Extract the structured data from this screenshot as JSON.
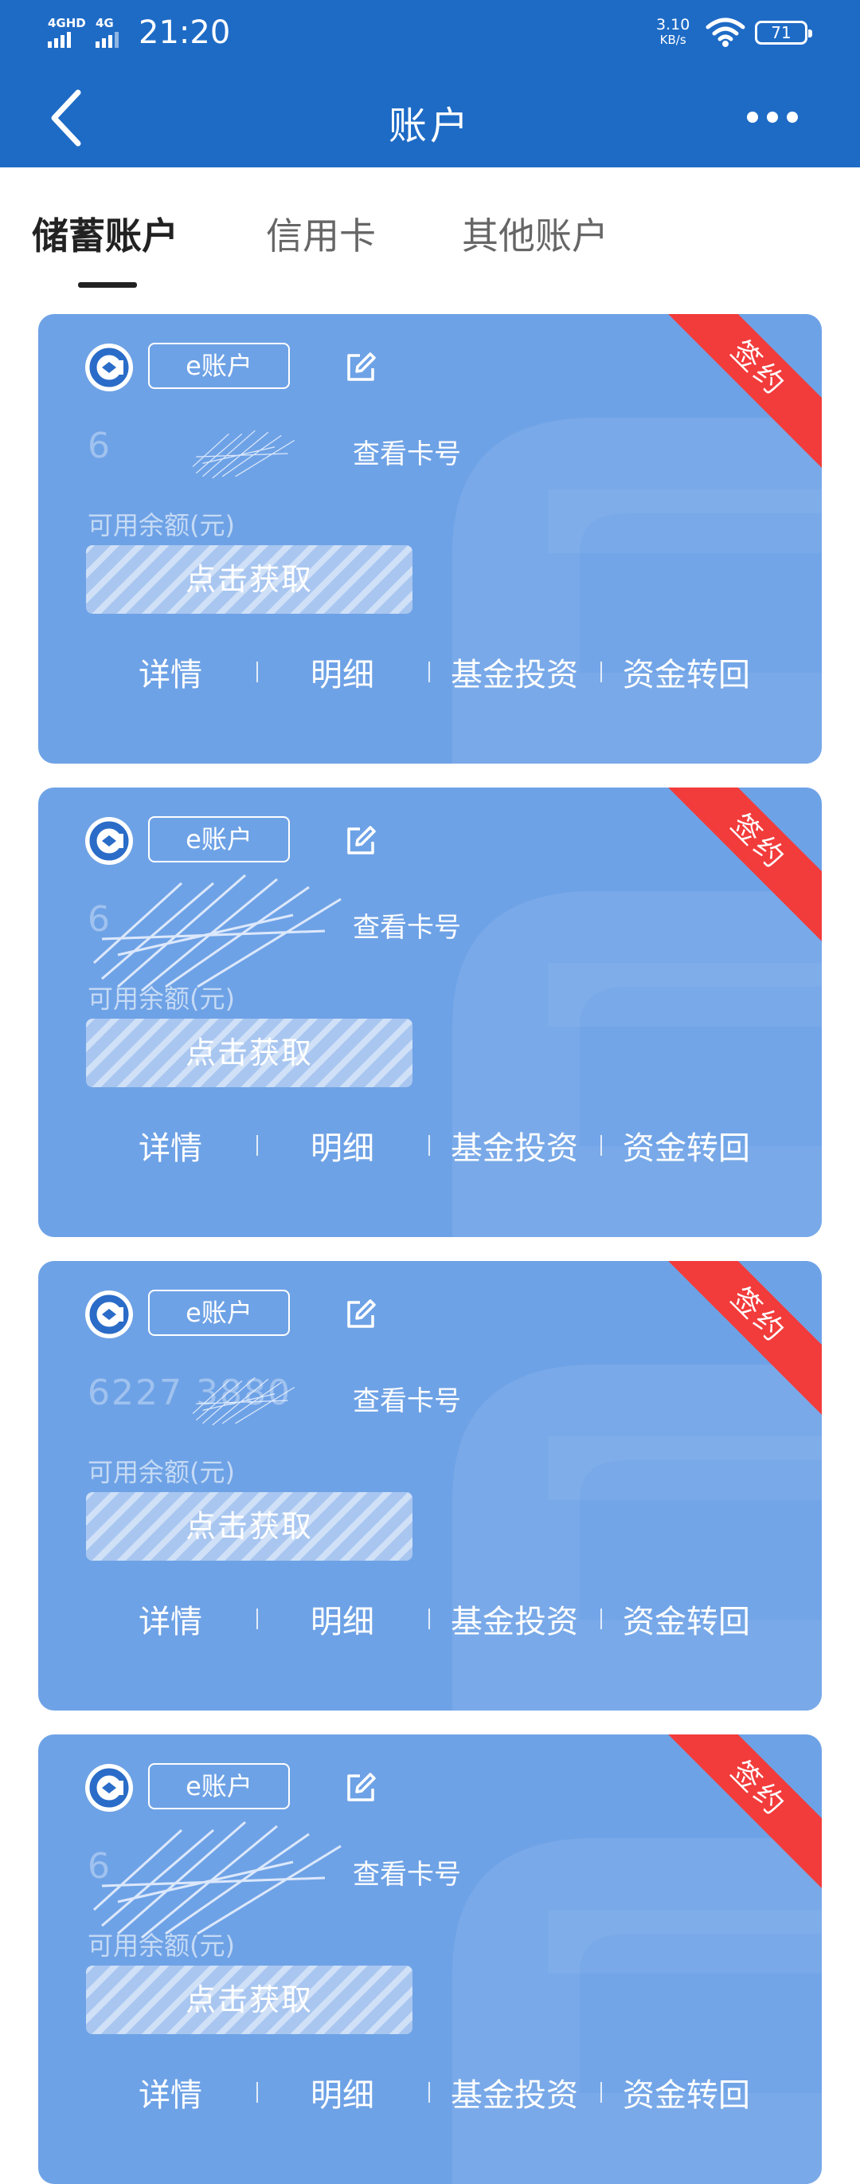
{
  "status_bar": {
    "signal1": "4GHD",
    "signal2": "4G",
    "time": "21:20",
    "net_speed": "3.10",
    "net_speed_unit": "KB/s",
    "battery": "71"
  },
  "header": {
    "title": "账户"
  },
  "tabs": [
    {
      "label": "储蓄账户",
      "active": true
    },
    {
      "label": "信用卡",
      "active": false
    },
    {
      "label": "其他账户",
      "active": false
    }
  ],
  "cards": [
    {
      "ribbon": "签约",
      "account_type": "e账户",
      "card_number": "6",
      "view_card_label": "查看卡号",
      "balance_label": "可用余额(元)",
      "fetch_label": "点击获取",
      "actions": [
        "详情",
        "明细",
        "基金投资",
        "资金转回"
      ]
    },
    {
      "ribbon": "签约",
      "account_type": "e账户",
      "card_number": "6",
      "view_card_label": "查看卡号",
      "balance_label": "可用余额(元)",
      "fetch_label": "点击获取",
      "actions": [
        "详情",
        "明细",
        "基金投资",
        "资金转回"
      ]
    },
    {
      "ribbon": "签约",
      "account_type": "e账户",
      "card_number": "6227  3880",
      "view_card_label": "查看卡号",
      "balance_label": "可用余额(元)",
      "fetch_label": "点击获取",
      "actions": [
        "详情",
        "明细",
        "基金投资",
        "资金转回"
      ]
    },
    {
      "ribbon": "签约",
      "account_type": "e账户",
      "card_number": "6",
      "view_card_label": "查看卡号",
      "balance_label": "可用余额(元)",
      "fetch_label": "点击获取",
      "actions": [
        "详情",
        "明细",
        "基金投资",
        "资金转回"
      ]
    }
  ],
  "colors": {
    "header": "#1e6bc6",
    "card": "#6ea2e6",
    "ribbon": "#f23b3b"
  },
  "icons": [
    "back-arrow-icon",
    "more-dots-icon",
    "bank-logo-icon",
    "edit-icon",
    "wifi-icon"
  ]
}
